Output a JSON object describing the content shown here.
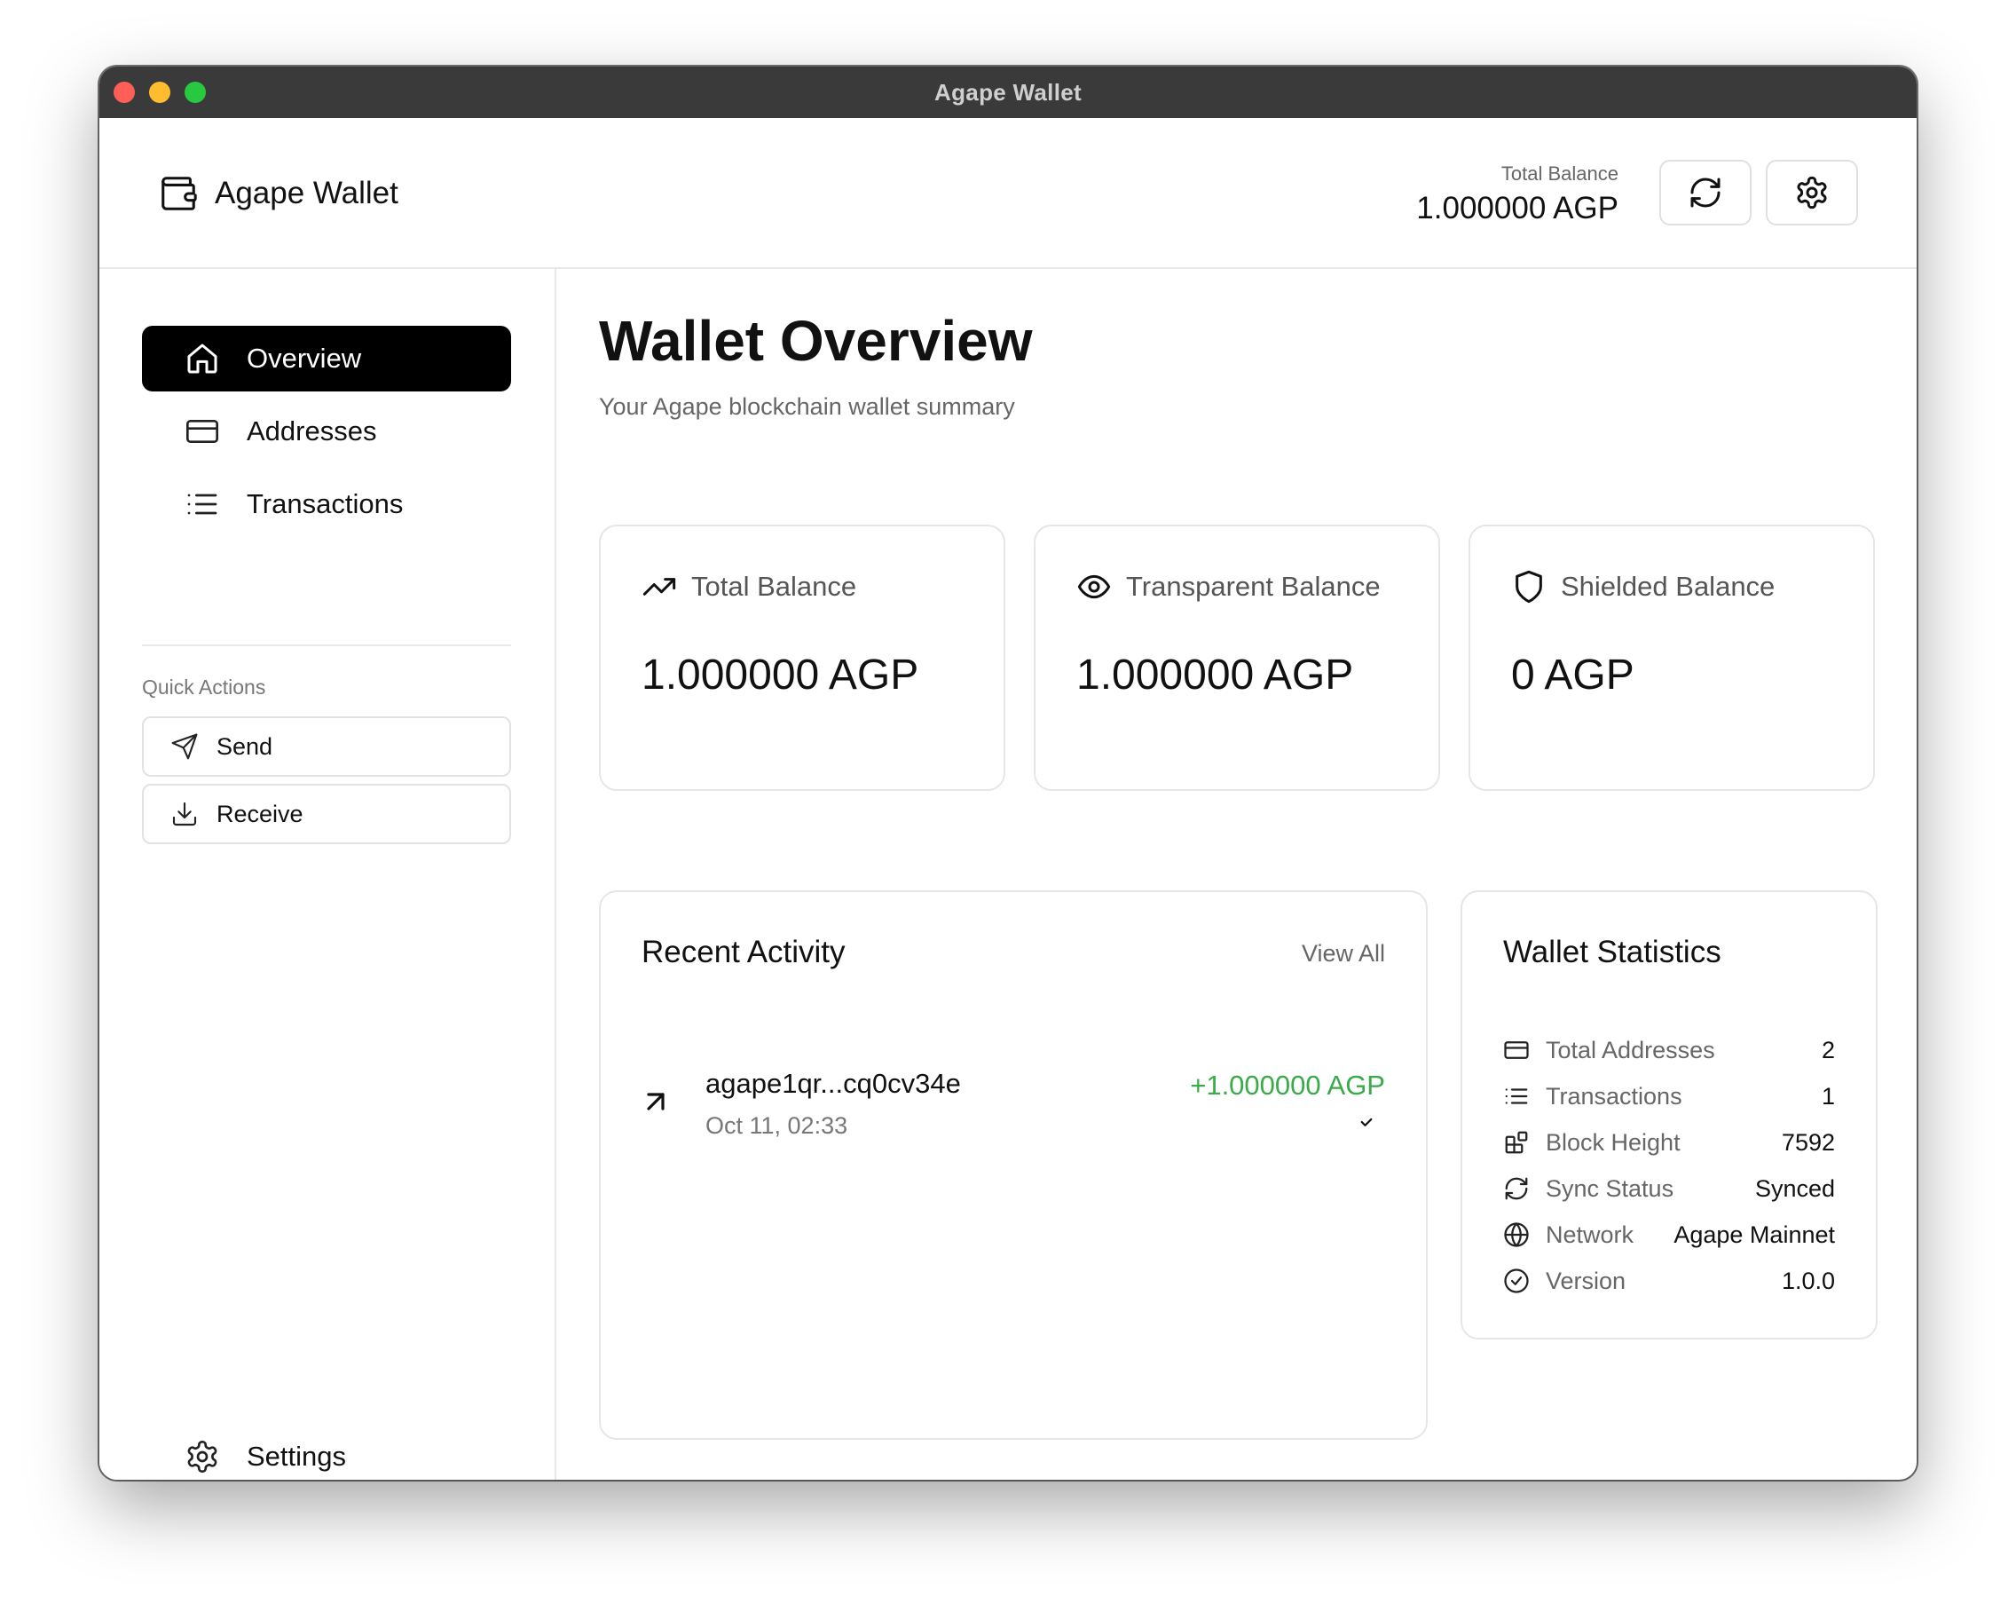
{
  "window": {
    "title": "Agape Wallet"
  },
  "header": {
    "brand_name": "Agape Wallet",
    "total_balance_label": "Total Balance",
    "total_balance_value": "1.000000 AGP"
  },
  "sidebar": {
    "items": [
      {
        "label": "Overview",
        "icon": "home-icon",
        "active": true
      },
      {
        "label": "Addresses",
        "icon": "card-icon",
        "active": false
      },
      {
        "label": "Transactions",
        "icon": "list-icon",
        "active": false
      }
    ],
    "quick_actions_label": "Quick Actions",
    "quick_actions": [
      {
        "label": "Send",
        "icon": "send-icon"
      },
      {
        "label": "Receive",
        "icon": "download-icon"
      }
    ],
    "settings_label": "Settings"
  },
  "main": {
    "title": "Wallet Overview",
    "subtitle": "Your Agape blockchain wallet summary",
    "balances": [
      {
        "label": "Total Balance",
        "value": "1.000000 AGP",
        "icon": "trending-up-icon"
      },
      {
        "label": "Transparent Balance",
        "value": "1.000000 AGP",
        "icon": "eye-icon"
      },
      {
        "label": "Shielded Balance",
        "value": "0 AGP",
        "icon": "shield-icon"
      }
    ],
    "recent_activity": {
      "title": "Recent Activity",
      "view_all": "View All",
      "items": [
        {
          "address": "agape1qr...cq0cv34e",
          "date": "Oct 11, 02:33",
          "amount": "+1.000000 AGP",
          "amount_color": "#3aaa4a"
        }
      ]
    },
    "stats": {
      "title": "Wallet Statistics",
      "rows": [
        {
          "label": "Total Addresses",
          "value": "2",
          "icon": "card-icon"
        },
        {
          "label": "Transactions",
          "value": "1",
          "icon": "list-icon"
        },
        {
          "label": "Block Height",
          "value": "7592",
          "icon": "blocks-icon"
        },
        {
          "label": "Sync Status",
          "value": "Synced",
          "icon": "refresh-icon"
        },
        {
          "label": "Network",
          "value": "Agape Mainnet",
          "icon": "globe-icon"
        },
        {
          "label": "Version",
          "value": "1.0.0",
          "icon": "check-circle-icon"
        }
      ]
    }
  },
  "colors": {
    "accent": "#000000",
    "positive": "#3aaa4a",
    "border": "#e6e6e6"
  }
}
